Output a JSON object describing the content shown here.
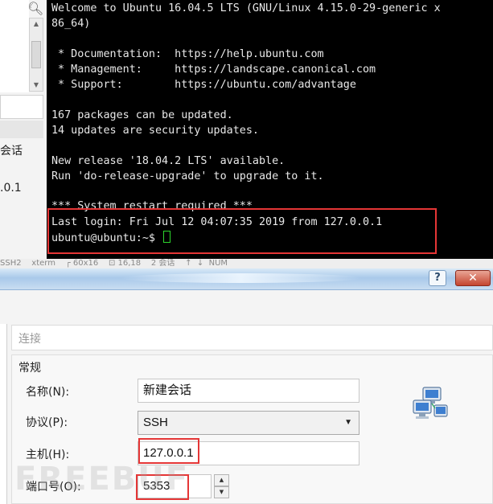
{
  "left_panel": {
    "search_icon": "magnifier-icon",
    "session_text": "会话",
    "ip_text": ".0.1"
  },
  "terminal": {
    "lines": [
      "Welcome to Ubuntu 16.04.5 LTS (GNU/Linux 4.15.0-29-generic x",
      "86_64)",
      " * Documentation:  https://help.ubuntu.com",
      " * Management:     https://landscape.canonical.com",
      " * Support:        https://ubuntu.com/advantage",
      "167 packages can be updated.",
      "14 updates are security updates.",
      "New release '18.04.2 LTS' available.",
      "Run 'do-release-upgrade' to upgrade to it.",
      "*** System restart required ***",
      "Last login: Fri Jul 12 04:07:35 2019 from 127.0.0.1",
      "ubuntu@ubuntu:~$ "
    ],
    "cursor_color": "#2dd62d"
  },
  "status_strip": "SSH2    xterm    ┌ 60x16    ⊡ 16,18    2 会话    ↑  ↓  NUM",
  "titlebar": {
    "help_label": "?",
    "close_label": "✕"
  },
  "dialog": {
    "connection_label": "连接",
    "section_general": "常规",
    "name_label": "名称(N):",
    "name_value": "新建会话",
    "protocol_label": "协议(P):",
    "protocol_value": "SSH",
    "host_label": "主机(H):",
    "host_value": "127.0.0.1",
    "port_label": "端口号(O):",
    "port_value": "5353",
    "session_icon": "network-computers-icon"
  },
  "watermark": "FREEBUF",
  "colors": {
    "highlight": "#e53636",
    "terminal_bg": "#000000",
    "terminal_fg": "#e8e8e8"
  }
}
